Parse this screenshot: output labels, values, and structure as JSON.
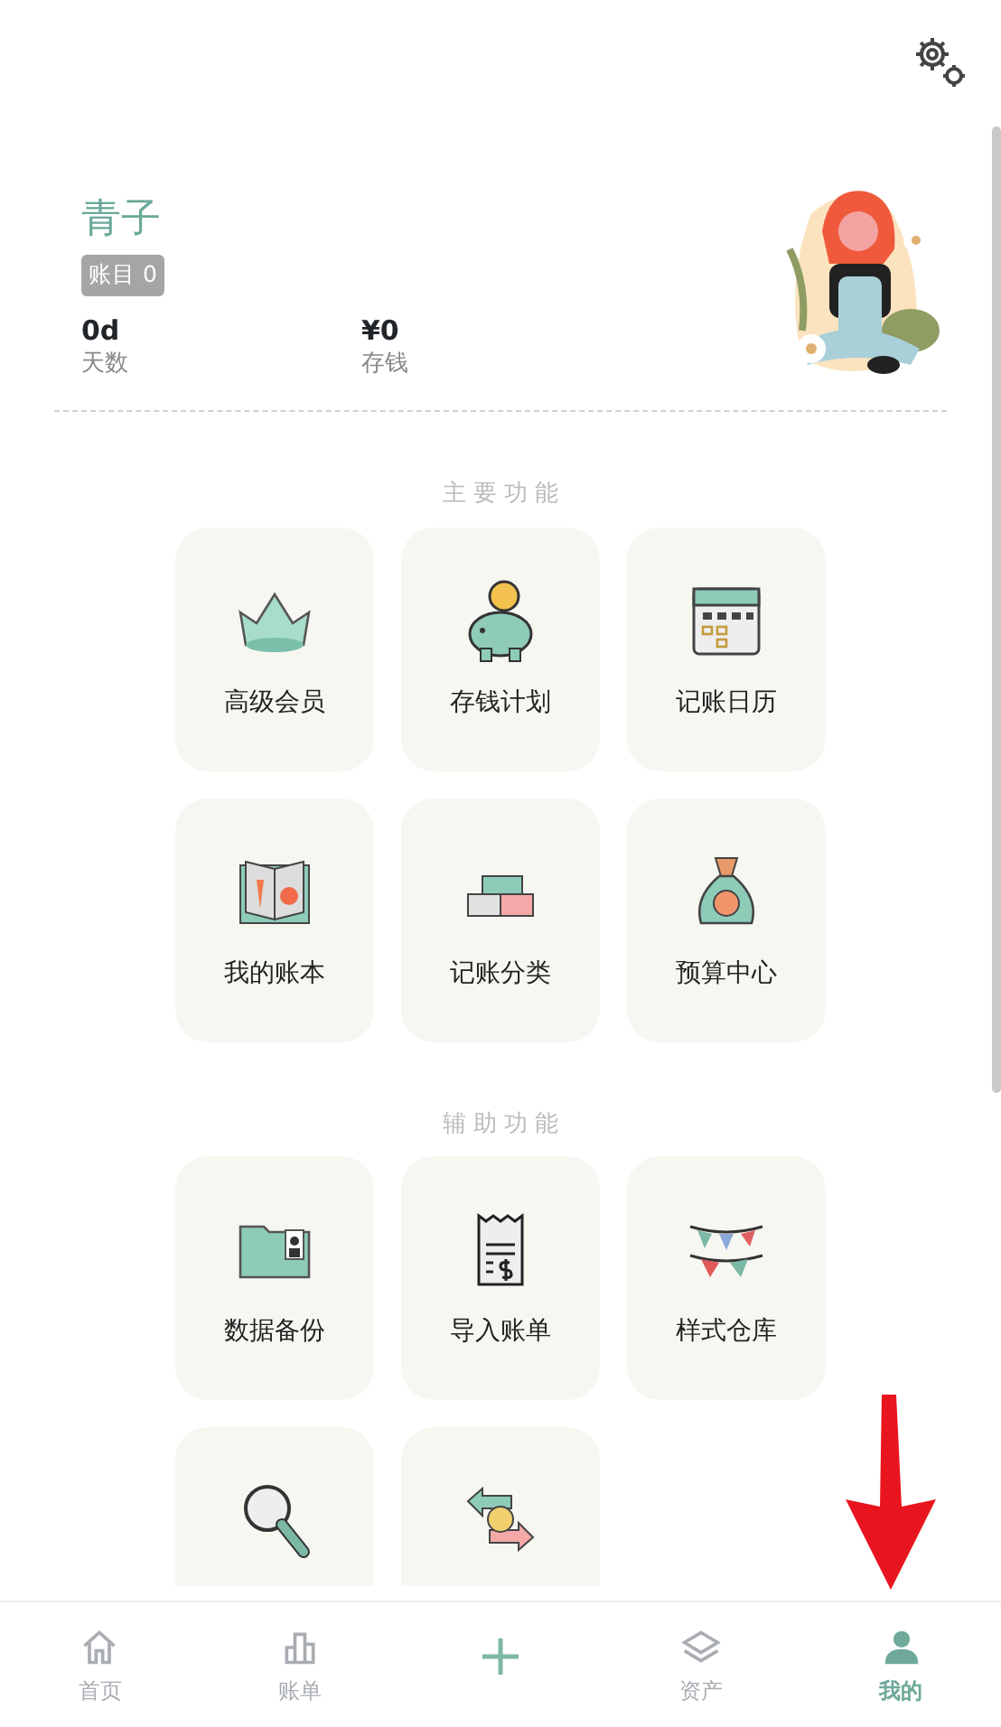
{
  "profile": {
    "name": "青子",
    "badge": "账目 0",
    "stats": [
      {
        "value": "0d",
        "label": "天数"
      },
      {
        "value": "¥0",
        "label": "存钱"
      }
    ]
  },
  "sections": [
    {
      "title": "主 要 功 能",
      "items": [
        {
          "kind": "full",
          "label": "高级会员"
        },
        {
          "kind": "full",
          "label": "存钱计划"
        },
        {
          "kind": "full",
          "label": "记账日历"
        },
        {
          "kind": "full",
          "label": "我的账本"
        },
        {
          "kind": "full",
          "label": "记账分类"
        },
        {
          "kind": "full",
          "label": "预算中心"
        }
      ]
    },
    {
      "title": "辅 助 功 能",
      "items": [
        {
          "kind": "full",
          "label": "数据备份"
        },
        {
          "kind": "full",
          "label": "导入账单"
        },
        {
          "kind": "full",
          "label": "样式仓库"
        },
        {
          "kind": "partial"
        },
        {
          "kind": "partial"
        }
      ]
    }
  ],
  "tab_bar": [
    {
      "kind": "tab",
      "label": "首页",
      "selected": false
    },
    {
      "kind": "tab",
      "label": "账单",
      "selected": false
    },
    {
      "kind": "add"
    },
    {
      "kind": "tab",
      "label": "资产",
      "selected": false
    },
    {
      "kind": "tab",
      "label": "我的",
      "selected": true
    }
  ]
}
